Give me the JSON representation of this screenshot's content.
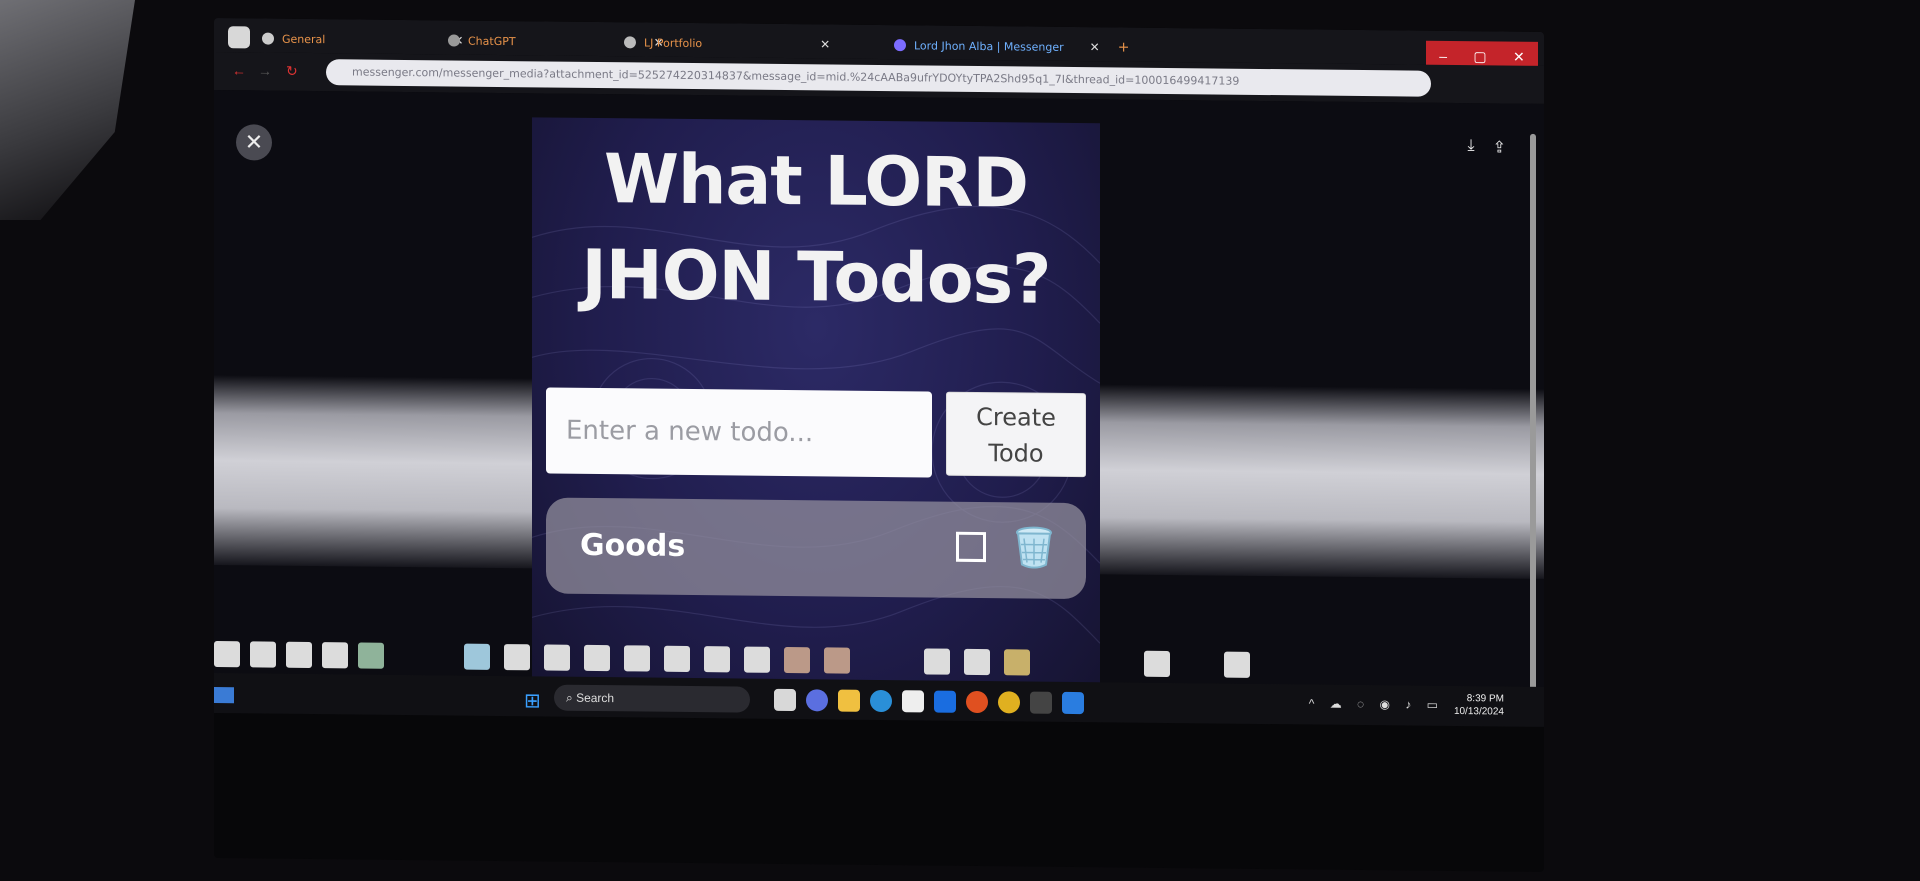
{
  "browser": {
    "tabs": [
      {
        "label": "General",
        "favicon": "github-icon"
      },
      {
        "label": "ChatGPT",
        "favicon": "chatgpt-icon"
      },
      {
        "label": "LJ Portfolio",
        "favicon": "portfolio-icon"
      },
      {
        "label": "Lord Jhon Alba | Messenger",
        "favicon": "messenger-icon",
        "active": true
      }
    ],
    "url": "messenger.com/messenger_media?attachment_id=525274220314837&message_id=mid.%24cAABa9ufrYDOYtyTPA2Shd95q1_7I&thread_id=100016499417139",
    "window_controls": [
      "–",
      "▢",
      "✕"
    ]
  },
  "viewer": {
    "close_icon": "✕"
  },
  "app": {
    "title": "What LORD JHON Todos?",
    "input_placeholder": "Enter a new todo...",
    "create_button": "Create Todo",
    "todos": [
      {
        "text": "Goods",
        "done": false
      }
    ]
  },
  "taskbar": {
    "search_label": "Search",
    "time": "8:39 PM",
    "date": "10/13/2024"
  },
  "colors": {
    "accent": "#c4242a",
    "app_bg": "#201d4d",
    "card_bg": "#9692a0"
  }
}
